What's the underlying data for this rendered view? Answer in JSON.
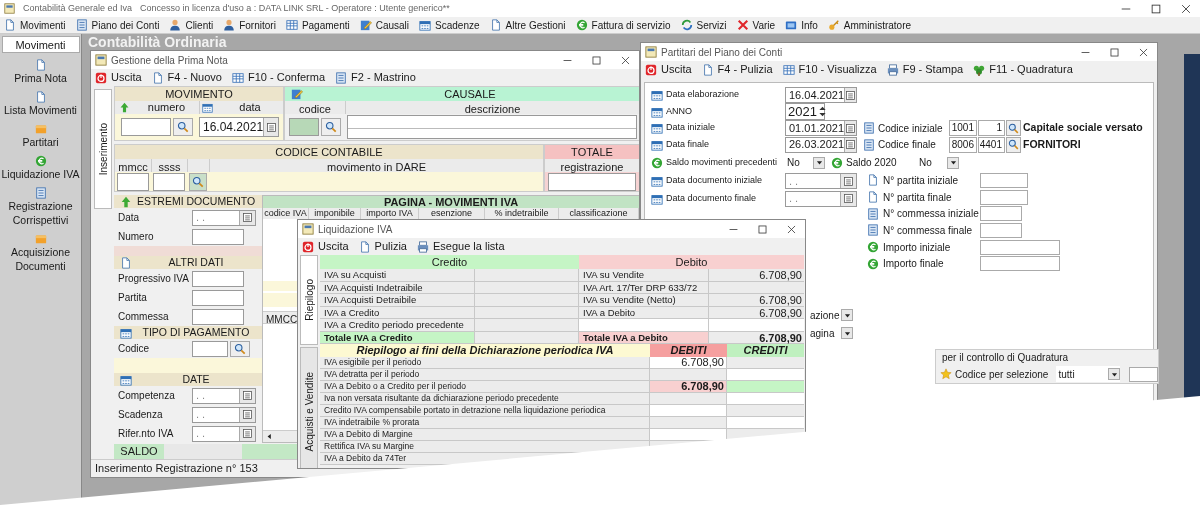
{
  "app": {
    "title": "Contabilità Generale ed Iva",
    "license": "Concesso in licenza d'uso a : DATA LINK SRL - Operatore : Utente generico**"
  },
  "menu": [
    {
      "label": "Movimenti"
    },
    {
      "label": "Piano dei Conti"
    },
    {
      "label": "Clienti"
    },
    {
      "label": "Fornitori"
    },
    {
      "label": "Pagamenti"
    },
    {
      "label": "Causali"
    },
    {
      "label": "Scadenze"
    },
    {
      "label": "Altre Gestioni"
    },
    {
      "label": "Fattura di servizio"
    },
    {
      "label": "Servizi"
    },
    {
      "label": "Varie"
    },
    {
      "label": "Info"
    },
    {
      "label": "Amministratore"
    }
  ],
  "sidebar": {
    "tab": "Movimenti",
    "items": [
      {
        "label": "Prima Nota"
      },
      {
        "label": "Lista Movimenti"
      },
      {
        "label": "Partitari"
      },
      {
        "label": "Liquidazione IVA"
      },
      {
        "label": "Registrazione Corrispettivi"
      },
      {
        "label": "Acquisizione Documenti"
      }
    ]
  },
  "desktop_title": "Contabilità Ordinaria",
  "prima_nota": {
    "title": "Gestione della Prima Nota",
    "toolbar": [
      "Uscita",
      "F4 - Nuovo",
      "F10 - Conferma",
      "F2 - Mastrino"
    ],
    "tab": {
      "label": "Inserimento",
      "selected": true
    },
    "movimento": {
      "header": "MOVIMENTO",
      "numero": "numero",
      "data_label": "data",
      "data": "16.04.2021"
    },
    "causale": {
      "header": "CAUSALE",
      "codice": "codice",
      "descrizione": "descrizione"
    },
    "codice_contabile": {
      "header": "CODICE CONTABILE",
      "columns": [
        "mmcc",
        "ssss",
        "movimento in DARE"
      ]
    },
    "totale": {
      "header": "TOTALE",
      "label": "registrazione"
    },
    "sections": [
      {
        "header": "ESTREMI DOCUMENTO",
        "fields": [
          {
            "label": "Data",
            "kind": "date",
            "placeholder": ". ."
          },
          {
            "label": "Numero",
            "kind": "text"
          }
        ]
      },
      {
        "header": "ALTRI DATI",
        "fields": [
          {
            "label": "Progressivo IVA",
            "kind": "text"
          },
          {
            "label": "Partita",
            "kind": "text"
          },
          {
            "label": "Commessa",
            "kind": "text"
          }
        ]
      },
      {
        "header": "TIPO DI PAGAMENTO",
        "fields": [
          {
            "label": "Codice",
            "kind": "lookup"
          }
        ]
      },
      {
        "header": "DATE",
        "fields": [
          {
            "label": "Competenza",
            "kind": "date",
            "placeholder": ". ."
          },
          {
            "label": "Scadenza",
            "kind": "date",
            "placeholder": ". ."
          },
          {
            "label": "Rifer.nto IVA",
            "kind": "date",
            "placeholder": ". ."
          }
        ]
      }
    ],
    "iva_table": {
      "header": "PAGINA - MOVIMENTI IVA",
      "columns": [
        "codice IVA",
        "imponibile",
        "importo IVA",
        "esenzione",
        "% indetraibile",
        "classificazione"
      ],
      "sub_column": "MMCC"
    },
    "saldo": "SALDO",
    "status": "Inserimento Registrazione n° 153"
  },
  "partitari": {
    "title": "Partitari del Piano dei Conti",
    "toolbar": [
      "Uscita",
      "F4 - Pulizia",
      "F10 - Visualizza",
      "F9 - Stampa",
      "F11 - Quadratura"
    ],
    "fields": [
      {
        "label": "Data elaborazione",
        "kind": "date",
        "value": "16.04.2021"
      },
      {
        "label": "ANNO",
        "kind": "spin",
        "value": "2021"
      },
      {
        "label": "Data iniziale",
        "kind": "date",
        "value": "01.01.2021"
      },
      {
        "label": "Data finale",
        "kind": "date",
        "value": "26.03.2021"
      },
      {
        "label": "Saldo movimenti precedenti",
        "kind": "select",
        "value": "No"
      },
      {
        "label": "Data documento iniziale",
        "kind": "date",
        "placeholder": ". ."
      },
      {
        "label": "Data documento finale",
        "kind": "date",
        "placeholder": ". ."
      }
    ],
    "codici": [
      {
        "label": "Codice iniziale",
        "mastro": "1001",
        "conto": "1",
        "description": "Capitale sociale versato"
      },
      {
        "label": "Codice finale",
        "mastro": "8006",
        "conto": "4401",
        "description": "FORNITORI"
      }
    ],
    "saldo_anno": {
      "label": "Saldo 2020",
      "value": "No"
    },
    "ranges": [
      {
        "label": "N° partita iniziale"
      },
      {
        "label": "N° partita finale"
      },
      {
        "label": "N° commessa iniziale"
      },
      {
        "label": "N° commessa finale"
      },
      {
        "label": "Importo iniziale"
      },
      {
        "label": "Importo finale"
      }
    ],
    "partial_selects": [
      "azione",
      "agina"
    ],
    "quadratura": {
      "legend": "per il controllo di Quadratura",
      "label": "Codice per selezione",
      "value": "tutti"
    }
  },
  "liquidazione": {
    "title": "Liquidazione IVA",
    "toolbar": [
      "Uscita",
      "Pulizia",
      "Esegue la lista"
    ],
    "tabs": [
      {
        "label": "Riepilogo",
        "selected": true
      },
      {
        "label": "Acquisti e Vendite",
        "selected": false
      }
    ],
    "credito_header": "Credito",
    "debito_header": "Debito",
    "credito": [
      {
        "label": "IVA su Acquisti",
        "total": false
      },
      {
        "label": "IVA Acquisti Indetraibile",
        "total": false
      },
      {
        "label": "IVA Acquisti Detraibile",
        "total": false
      },
      {
        "label": "IVA a Credito",
        "total": false
      },
      {
        "label": "IVA a Credito periodo precedente",
        "total": false
      },
      {
        "label": "Totale IVA a Credito",
        "total": true
      }
    ],
    "debito": [
      {
        "label": "IVA su Vendite",
        "value": "6.708,90",
        "total": false
      },
      {
        "label": "IVA Art. 17/Ter DRP 633/72",
        "total": false
      },
      {
        "label": "IVA su Vendite (Netto)",
        "value": "6.708,90",
        "total": false
      },
      {
        "label": "IVA a Debito",
        "value": "6.708,90",
        "total": false
      },
      {
        "total": false
      },
      {
        "label": "Totale IVA a Debito",
        "value": "6.708,90",
        "total": true
      }
    ],
    "riepilogo": {
      "header": "Riepilogo ai fini della Dichiarazione periodica IVA",
      "debiti": "DEBITI",
      "crediti": "CREDITI",
      "rows": [
        {
          "label": "IVA esigibile per il periodo",
          "debiti": "6.708,90",
          "highlight": false
        },
        {
          "label": "IVA detratta per il periodo",
          "highlight": false
        },
        {
          "label": "IVA a Debito o a Credito per il periodo",
          "debiti": "6.708,90",
          "highlight": true
        },
        {
          "label": "Iva non versata risultante da dichiarazione periodo precedente",
          "highlight": false
        },
        {
          "label": "Credito IVA compensabile portato in detrazione nella liquidazione periodica",
          "highlight": false
        },
        {
          "label": "IVA indetraibile % prorata",
          "highlight": false
        },
        {
          "label": "IVA a Debito di Margine",
          "highlight": false
        },
        {
          "label": "Rettifica IVA su Margine",
          "highlight": false
        },
        {
          "label": "IVA a Debito da 74Ter"
        }
      ]
    }
  }
}
